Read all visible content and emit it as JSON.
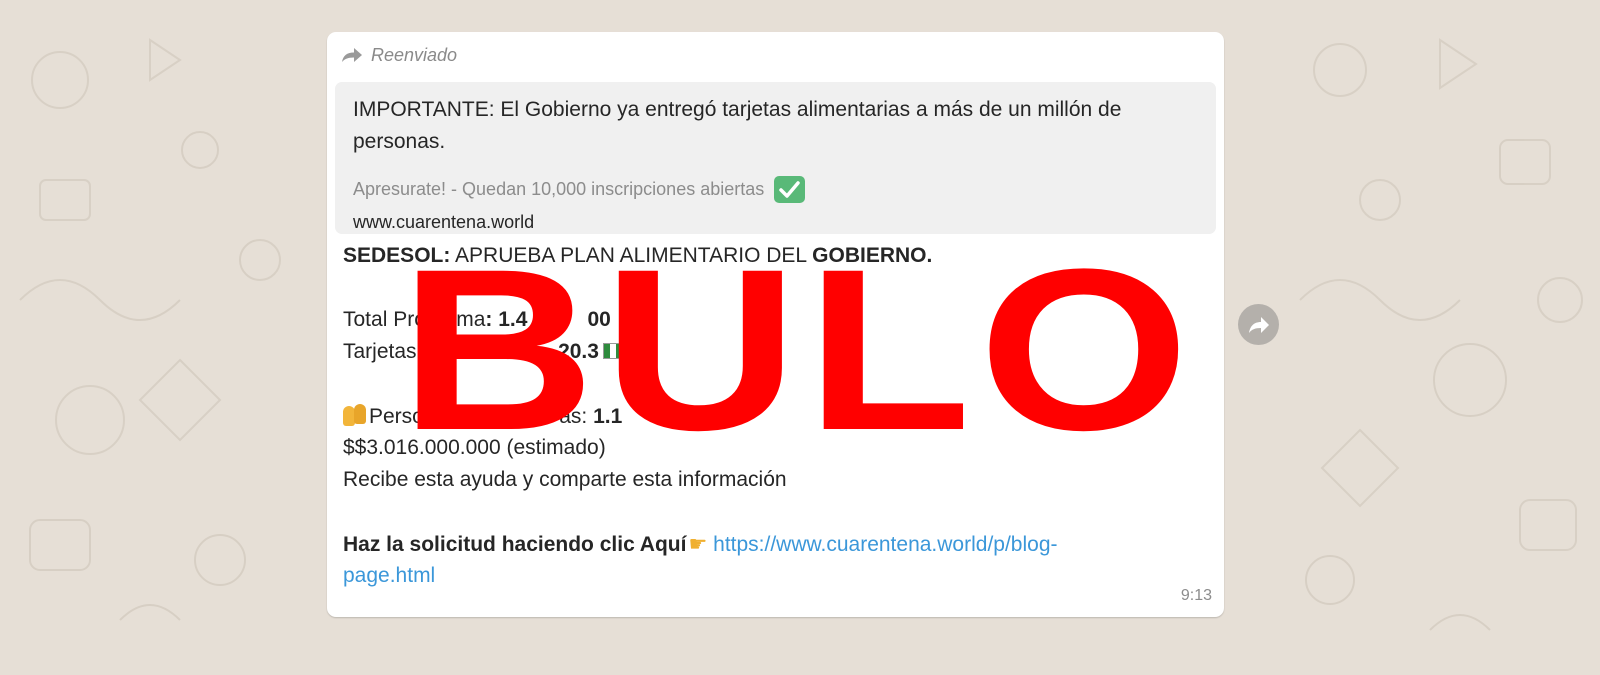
{
  "forwarded_label": "Reenviado",
  "link_preview": {
    "title": "IMPORTANTE: El Gobierno ya entregó tarjetas alimentarias a más de un millón de personas.",
    "description": "Apresurate! - Quedan 10,000 inscripciones abiertas",
    "url": "www.cuarentena.world"
  },
  "message": {
    "line1_bold": "SEDESOL:",
    "line1_text": " APRUEBA PLAN ALIMENTARIO DEL ",
    "line1_bold2": "GOBIERNO.",
    "total_label": "Total Programa",
    "total_value": ": 1.4",
    "total_value_end": "00",
    "tarjetas_label": "Tarjetas En",
    "tarjetas_value": "20.3",
    "personas_label": "Persona",
    "personas_mid": "as: ",
    "personas_value": "1.1",
    "amount": "$$3.016.000.000 (estimado)",
    "cta_line": "Recibe esta ayuda y comparte esta información",
    "request_bold": "Haz la solicitud haciendo clic Aquí",
    "request_link_part1": "https://www.cuarentena.world/p/blog-",
    "request_link_part2": "page.html",
    "time": "9:13"
  },
  "stamp_text": "BULO",
  "colors": {
    "stamp": "#ff0000",
    "link": "#3b97d9",
    "preview_bg": "#f0f0f0",
    "wallpaper": "#e6dfd6",
    "check_bg": "#59b978"
  },
  "icons": {
    "forward": "forward-arrow-icon",
    "check": "check-mark-button-icon",
    "share": "share-forward-icon"
  }
}
